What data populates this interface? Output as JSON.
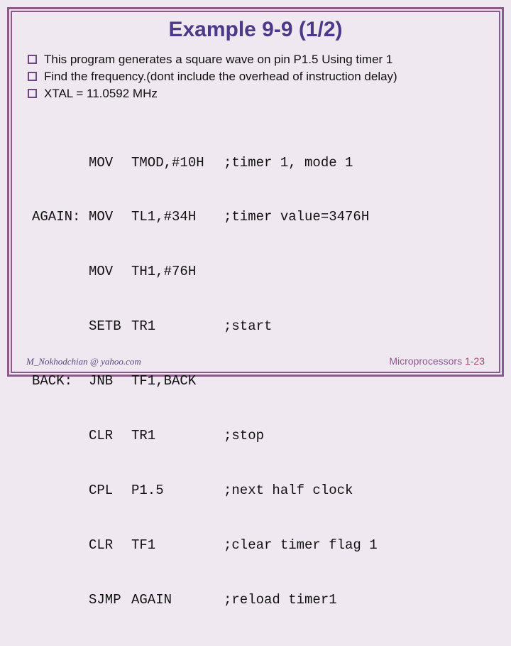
{
  "title": "Example 9-9 (1/2)",
  "bullets": [
    "This  program generates a square wave on pin P1.5 Using  timer 1",
    "Find the frequency.(dont include the overhead of instruction delay)",
    "XTAL = 11.0592 MHz"
  ],
  "code": [
    {
      "label": "",
      "op": "MOV",
      "arg": "TMOD,#10H",
      "cmt": ";timer 1, mode 1"
    },
    {
      "label": "AGAIN:",
      "op": "MOV",
      "arg": "TL1,#34H",
      "cmt": ";timer value=3476H"
    },
    {
      "label": "",
      "op": "MOV",
      "arg": "TH1,#76H",
      "cmt": ""
    },
    {
      "label": "",
      "op": "SETB",
      "arg": "TR1",
      "cmt": ";start"
    },
    {
      "label": "BACK:",
      "op": "JNB",
      "arg": "TF1,BACK",
      "cmt": ""
    },
    {
      "label": "",
      "op": "CLR",
      "arg": "TR1",
      "cmt": ";stop"
    },
    {
      "label": "",
      "op": "CPL",
      "arg": "P1.5",
      "cmt": ";next half clock"
    },
    {
      "label": "",
      "op": "CLR",
      "arg": "TF1",
      "cmt": ";clear timer flag 1"
    },
    {
      "label": "",
      "op": "SJMP",
      "arg": "AGAIN",
      "cmt": ";reload timer1"
    }
  ],
  "footer": {
    "left": "M_Nokhodchian @ yahoo.com",
    "right_text": "Microprocessors ",
    "page": "1-23"
  }
}
